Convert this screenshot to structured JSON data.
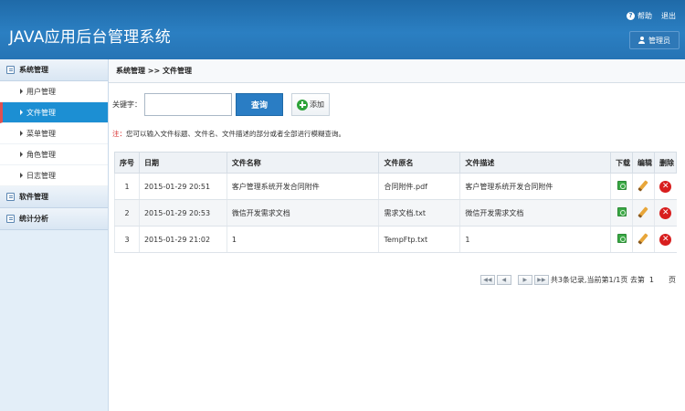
{
  "header": {
    "title": "JAVA应用后台管理系统",
    "help": "帮助",
    "logout": "退出",
    "user": "管理员"
  },
  "sidebar": {
    "groups": [
      {
        "label": "系统管理",
        "items": [
          "用户管理",
          "文件管理",
          "菜单管理",
          "角色管理",
          "日志管理"
        ]
      },
      {
        "label": "软件管理"
      },
      {
        "label": "统计分析"
      }
    ],
    "active_item": "文件管理"
  },
  "breadcrumb": "系统管理 >> 文件管理",
  "search": {
    "label": "关键字：",
    "value": "",
    "query_button": "查询",
    "add_button": "添加"
  },
  "note": {
    "prefix": "注：",
    "text": "您可以输入文件标题、文件名、文件描述的部分或者全部进行模糊查询。"
  },
  "table": {
    "headers": [
      "序号",
      "日期",
      "文件名称",
      "文件原名",
      "文件描述",
      "下载",
      "编辑",
      "删除"
    ],
    "rows": [
      {
        "no": "1",
        "date": "2015-01-29 20:51",
        "name": "客户管理系统开发合同附件",
        "original": "合同附件.pdf",
        "desc": "客户管理系统开发合同附件"
      },
      {
        "no": "2",
        "date": "2015-01-29 20:53",
        "name": "微信开发需求文档",
        "original": "需求文档.txt",
        "desc": "微信开发需求文档"
      },
      {
        "no": "3",
        "date": "2015-01-29 21:02",
        "name": "1",
        "original": "TempFtp.txt",
        "desc": "1"
      }
    ]
  },
  "pager": {
    "summary": "共3条记录,当前第1/1页 去第",
    "goto_value": "1",
    "suffix": "页"
  }
}
